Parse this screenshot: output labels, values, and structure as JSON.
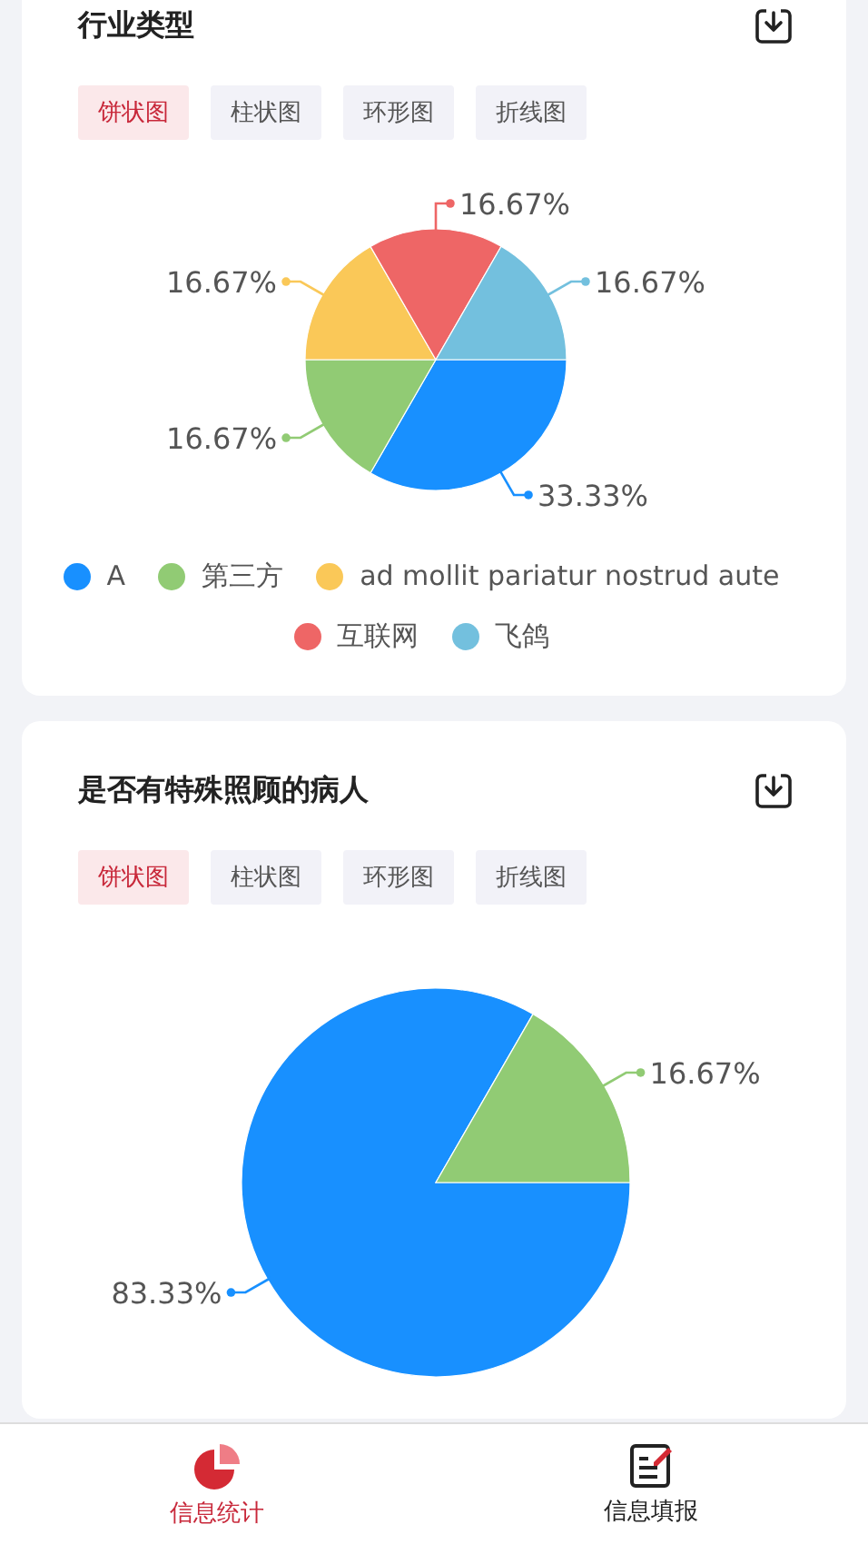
{
  "cards": [
    {
      "title": "行业类型",
      "tabs": [
        {
          "label": "饼状图",
          "selected": true
        },
        {
          "label": "柱状图",
          "selected": false
        },
        {
          "label": "环形图",
          "selected": false
        },
        {
          "label": "折线图",
          "selected": false
        }
      ],
      "chart_data": {
        "type": "pie",
        "categories": [
          "A",
          "第三方",
          "ad mollit pariatur nostrud aute",
          "互联网",
          "飞鸽"
        ],
        "values": [
          33.33,
          16.67,
          16.67,
          16.67,
          16.67
        ],
        "colors": [
          "#1890ff",
          "#91cb74",
          "#fac858",
          "#ee6666",
          "#73c0de"
        ],
        "data_labels": true,
        "value_labels": [
          "33.33%",
          "16.67%",
          "16.67%",
          "16.67%",
          "16.67%"
        ]
      }
    },
    {
      "title": "是否有特殊照顾的病人",
      "tabs": [
        {
          "label": "饼状图",
          "selected": true
        },
        {
          "label": "柱状图",
          "selected": false
        },
        {
          "label": "环形图",
          "selected": false
        },
        {
          "label": "折线图",
          "selected": false
        }
      ],
      "chart_data": {
        "type": "pie",
        "values": [
          83.33,
          16.67
        ],
        "colors": [
          "#1890ff",
          "#91cb74"
        ],
        "data_labels": true,
        "value_labels": [
          "83.33%",
          "16.67%"
        ]
      }
    }
  ],
  "nav": [
    {
      "label": "信息统计",
      "kind": "stats",
      "selected": true
    },
    {
      "label": "信息填报",
      "kind": "form",
      "selected": false
    }
  ]
}
